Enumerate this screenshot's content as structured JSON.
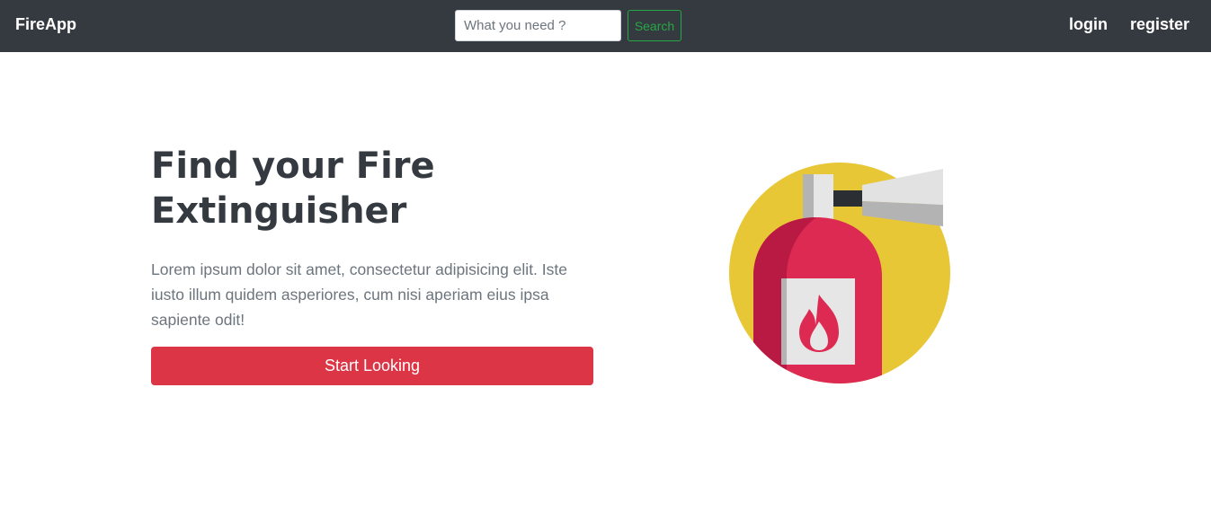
{
  "navbar": {
    "brand": "FireApp",
    "search": {
      "placeholder": "What you need ?",
      "value": "",
      "button_label": "Search"
    },
    "links": {
      "login": "login",
      "register": "register"
    }
  },
  "hero": {
    "title": "Find your Fire Extinguisher",
    "description": "Lorem ipsum dolor sit amet, consectetur adipisicing elit. Iste iusto illum quidem asperiores, cum nisi aperiam eius ipsa sapiente odit!",
    "cta_label": "Start Looking",
    "illustration_icon": "fire-extinguisher-icon"
  },
  "colors": {
    "navbar_bg": "#343a40",
    "search_button": "#28a745",
    "cta": "#dc3545",
    "illustration_circle": "#e8c737",
    "extinguisher_body": "#dd2a52"
  }
}
